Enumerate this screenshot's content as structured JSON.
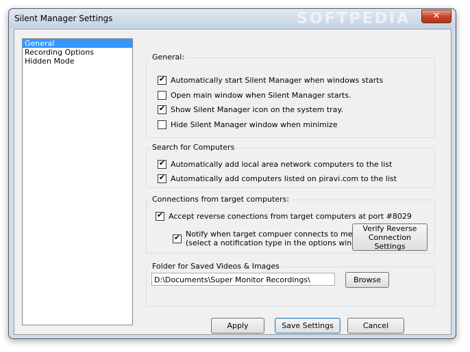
{
  "window": {
    "title": "Silent Manager Settings",
    "watermark": "SOFTPEDIA",
    "close_glyph": "✕"
  },
  "nav": {
    "items": [
      {
        "label": "General",
        "selected": true
      },
      {
        "label": "Recording Options",
        "selected": false
      },
      {
        "label": "Hidden Mode",
        "selected": false
      }
    ]
  },
  "general": {
    "legend": "General:",
    "options": [
      {
        "label": "Automatically start Silent Manager when windows starts",
        "checked": true
      },
      {
        "label": "Open main window when Silent Manager starts.",
        "checked": false
      },
      {
        "label": "Show Silent Manager  icon on the system tray.",
        "checked": true
      },
      {
        "label": "Hide Silent Manager window when minimize",
        "checked": false
      }
    ]
  },
  "search": {
    "legend": "Search for Computers",
    "options": [
      {
        "label": "Automatically add local area network computers to the list",
        "checked": true
      },
      {
        "label": "Automatically add computers listed on piravi.com to the list",
        "checked": true
      }
    ]
  },
  "connections": {
    "legend": "Connections from target computers:",
    "accept_label": "Accept reverse conections from target computers at port #8029",
    "accept_checked": true,
    "notify_line1": "Notify when target compuer connects to me.",
    "notify_line2": "(select a notification type in the options window)",
    "notify_checked": true,
    "verify_line1": "Verify Reverse",
    "verify_line2": "Connection Settings"
  },
  "folder": {
    "legend": "Folder for Saved Videos & Images",
    "path": "D:\\Documents\\Super Monitor Recordings\\",
    "browse_label": "Browse"
  },
  "footer": {
    "apply_label": "Apply",
    "save_label": "Save Settings",
    "cancel_label": "Cancel"
  },
  "check_glyph": "✔"
}
